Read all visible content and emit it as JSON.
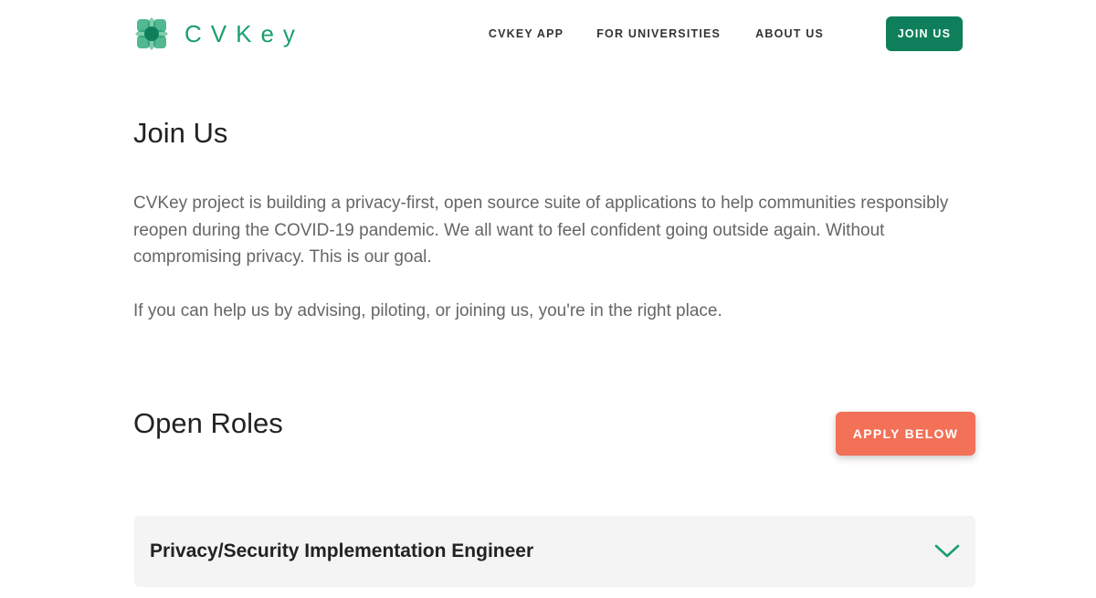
{
  "header": {
    "logo_text": "CVKey",
    "nav": {
      "app": "CVKEY APP",
      "universities": "FOR UNIVERSITIES",
      "about": "ABOUT US",
      "join": "JOIN US"
    }
  },
  "main": {
    "title": "Join Us",
    "intro": "CVKey project is building a privacy-first, open source suite of applications to help communities responsibly reopen during the COVID-19 pandemic. We all want to feel confident going outside again. Without compromising privacy. This is our goal.",
    "intro2": "If you can help us by advising, piloting, or joining us, you're in the right place.",
    "roles_title": "Open Roles",
    "apply_label": "APPLY BELOW",
    "roles": [
      {
        "title": "Privacy/Security Implementation Engineer"
      }
    ]
  },
  "icons": {
    "logo": "cvkey-logo-icon",
    "expand": "chevron-down-icon"
  },
  "colors": {
    "brand_green": "#0e7f5a",
    "logo_green": "#1aa06d",
    "accent_coral": "#f37157",
    "card_bg": "#f4f4f4"
  }
}
